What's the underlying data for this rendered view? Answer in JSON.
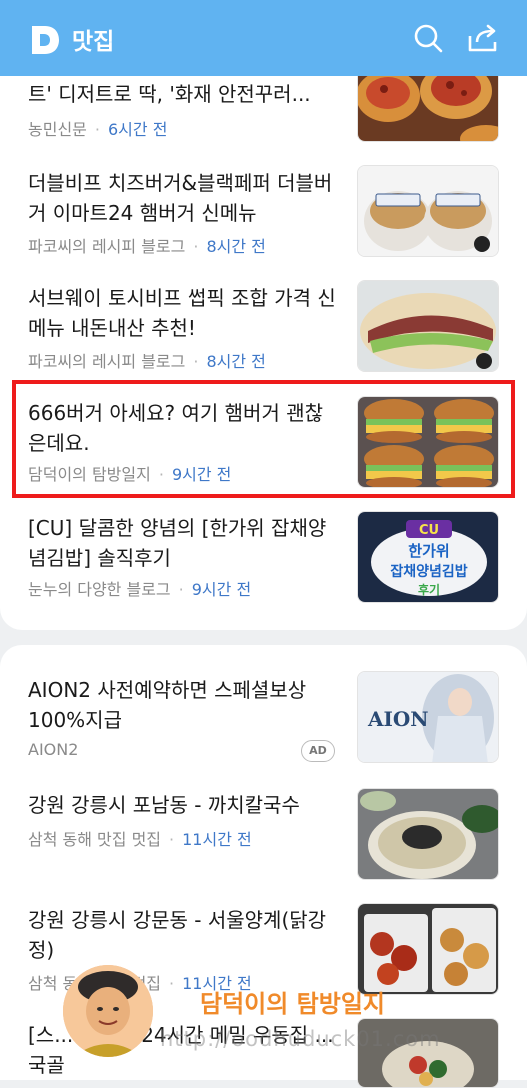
{
  "header": {
    "logo_letter": "D",
    "title": "맛집",
    "colors": {
      "bar": "#60b3f1"
    }
  },
  "feed1": [
    {
      "title": "트' 디저트로 딱, '화재 안전꾸러...",
      "source": "농민신문",
      "time": "6시간 전",
      "thumb": "tarts-photo"
    },
    {
      "title": "더블비프 치즈버거&블랙페퍼 더블버거 이마트24 햄버거 신메뉴",
      "source": "파코씨의 레시피 블로그",
      "time": "8시간 전",
      "thumb": "packaged-burgers-photo"
    },
    {
      "title": "서브웨이 토시비프 썹픽 조합 가격 신메뉴 내돈내산 추천!",
      "source": "파코씨의 레시피 블로그",
      "time": "8시간 전",
      "thumb": "sandwich-photo"
    },
    {
      "title": "666버거 아세요? 여기 햄버거 괜찮은데요.",
      "source": "담덕이의 탐방일지",
      "time": "9시간 전",
      "thumb": "four-burgers-photo"
    },
    {
      "title": "[CU] 달콤한 양념의 [한가위 잡채양념김밥] 솔직후기",
      "source": "눈누의 다양한 블로그",
      "time": "9시간 전",
      "thumb": "cu-kimbap-poster",
      "thumb_text": [
        "CU",
        "한가위",
        "잡채양념김밥",
        "후기"
      ]
    }
  ],
  "feed2": [
    {
      "title": "AION2 사전예약하면 스페셜보상 100%지급",
      "source": "AION2",
      "badge": "AD",
      "thumb": "aion-banner",
      "thumb_text": "AION"
    },
    {
      "title": "강원 강릉시 포남동 - 까치칼국수",
      "source": "삼척 동해 맛집 멋집",
      "time": "11시간 전",
      "thumb": "noodle-soup-photo"
    },
    {
      "title": "강원 강릉시 강문동 - 서울양계(닭강정)",
      "source": "삼척 동해 맛집 멋집",
      "time": "11시간 전",
      "thumb": "fried-chicken-photo"
    },
    {
      "title": "[스... 제물포 24시간 메밀 우동집 ...국골",
      "thumb": "bibimbap-photo"
    }
  ],
  "watermark": {
    "signature": "담덕이의 탐방일지",
    "url": "http://oodhuduck01.com"
  }
}
